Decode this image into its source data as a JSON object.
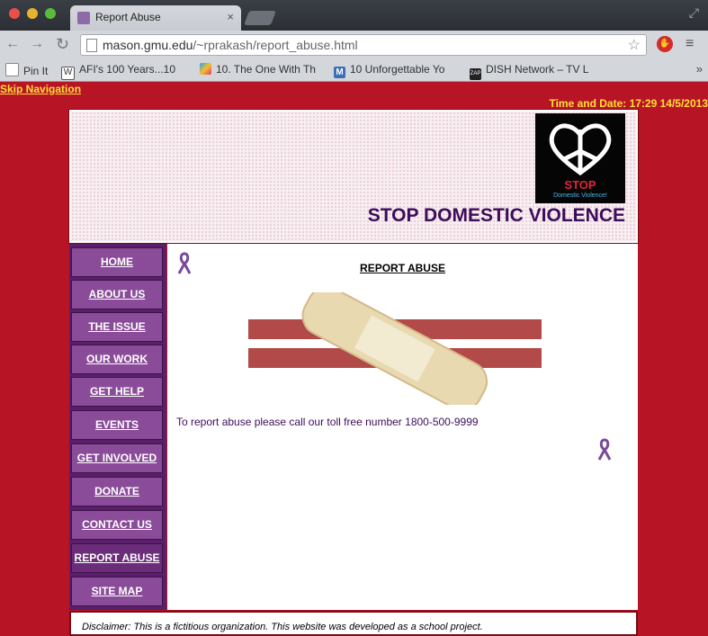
{
  "browser": {
    "tab_title": "Report Abuse",
    "tab_close": "×",
    "url_host": "mason.gmu.edu",
    "url_path": "/~rprakash/report_abuse.html",
    "back_glyph": "←",
    "forward_glyph": "→",
    "reload_glyph": "↻",
    "star_glyph": "☆",
    "menu_glyph": "≡",
    "restore_glyph": "⤢",
    "bookmarks": [
      {
        "label": "Pin It",
        "icon": "page-icon",
        "color": "#ffffff"
      },
      {
        "label": "AFI's 100 Years...10",
        "icon": "wikipedia-icon",
        "color": "#ffffff"
      },
      {
        "label": "10. The One With Th",
        "icon": "colorful-figure-icon",
        "color": "#2a9df4"
      },
      {
        "label": "10 Unforgettable Yo",
        "icon": "m-icon",
        "color": "#3b6fb6"
      },
      {
        "label": "DISH Network – TV L",
        "icon": "zap2it-icon",
        "color": "#222222"
      }
    ],
    "bookmarks_more": "»"
  },
  "page": {
    "skip_nav": "Skip Navigation",
    "datetime": "Time and Date: 17:29 14/5/2013",
    "site_title": "STOP DOMESTIC VIOLENCE",
    "logo_stop": "STOP",
    "logo_sub": "Domestic Violence!",
    "content_title": "REPORT ABUSE",
    "report_text": "To report abuse please call our toll free number 1800-500-9999",
    "disclaimer": "Disclaimer: This is a fictitious organization. This website was developed as a school project."
  },
  "nav": [
    {
      "label": "HOME"
    },
    {
      "label": "ABOUT US"
    },
    {
      "label": "THE ISSUE"
    },
    {
      "label": "OUR WORK"
    },
    {
      "label": "GET HELP"
    },
    {
      "label": "EVENTS"
    },
    {
      "label": "GET INVOLVED"
    },
    {
      "label": "DONATE"
    },
    {
      "label": "CONTACT US"
    },
    {
      "label": "REPORT ABUSE",
      "active": true
    },
    {
      "label": "SITE MAP"
    }
  ],
  "colors": {
    "page_background": "#b71426",
    "accent_purple": "#8a4c98",
    "title_purple": "#3d0c5a",
    "link_yellow": "#ffe033"
  }
}
